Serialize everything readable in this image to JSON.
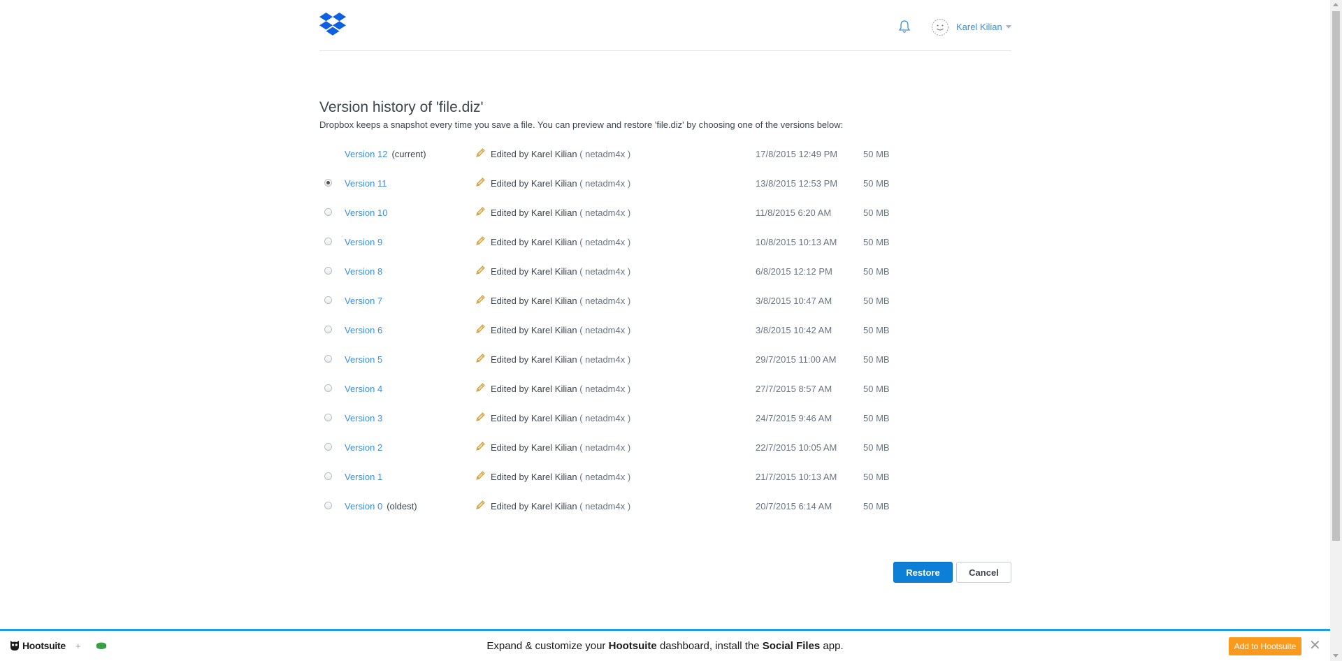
{
  "header": {
    "user_name": "Karel Kilian"
  },
  "page": {
    "title": "Version history of 'file.diz'",
    "description": "Dropbox keeps a snapshot every time you save a file. You can preview and restore 'file.diz' by choosing one of the versions below:"
  },
  "versions": [
    {
      "label": "Version 12",
      "note": "(current)",
      "editor": "Edited by Karel Kilian",
      "uid": "( netadm4x )",
      "date": "17/8/2015 12:49 PM",
      "size": "50 MB",
      "has_radio": false,
      "selected": false
    },
    {
      "label": "Version 11",
      "note": "",
      "editor": "Edited by Karel Kilian",
      "uid": "( netadm4x )",
      "date": "13/8/2015 12:53 PM",
      "size": "50 MB",
      "has_radio": true,
      "selected": true
    },
    {
      "label": "Version 10",
      "note": "",
      "editor": "Edited by Karel Kilian",
      "uid": "( netadm4x )",
      "date": "11/8/2015 6:20 AM",
      "size": "50 MB",
      "has_radio": true,
      "selected": false
    },
    {
      "label": "Version 9",
      "note": "",
      "editor": "Edited by Karel Kilian",
      "uid": "( netadm4x )",
      "date": "10/8/2015 10:13 AM",
      "size": "50 MB",
      "has_radio": true,
      "selected": false
    },
    {
      "label": "Version 8",
      "note": "",
      "editor": "Edited by Karel Kilian",
      "uid": "( netadm4x )",
      "date": "6/8/2015 12:12 PM",
      "size": "50 MB",
      "has_radio": true,
      "selected": false
    },
    {
      "label": "Version 7",
      "note": "",
      "editor": "Edited by Karel Kilian",
      "uid": "( netadm4x )",
      "date": "3/8/2015 10:47 AM",
      "size": "50 MB",
      "has_radio": true,
      "selected": false
    },
    {
      "label": "Version 6",
      "note": "",
      "editor": "Edited by Karel Kilian",
      "uid": "( netadm4x )",
      "date": "3/8/2015 10:42 AM",
      "size": "50 MB",
      "has_radio": true,
      "selected": false
    },
    {
      "label": "Version 5",
      "note": "",
      "editor": "Edited by Karel Kilian",
      "uid": "( netadm4x )",
      "date": "29/7/2015 11:00 AM",
      "size": "50 MB",
      "has_radio": true,
      "selected": false
    },
    {
      "label": "Version 4",
      "note": "",
      "editor": "Edited by Karel Kilian",
      "uid": "( netadm4x )",
      "date": "27/7/2015 8:57 AM",
      "size": "50 MB",
      "has_radio": true,
      "selected": false
    },
    {
      "label": "Version 3",
      "note": "",
      "editor": "Edited by Karel Kilian",
      "uid": "( netadm4x )",
      "date": "24/7/2015 9:46 AM",
      "size": "50 MB",
      "has_radio": true,
      "selected": false
    },
    {
      "label": "Version 2",
      "note": "",
      "editor": "Edited by Karel Kilian",
      "uid": "( netadm4x )",
      "date": "22/7/2015 10:05 AM",
      "size": "50 MB",
      "has_radio": true,
      "selected": false
    },
    {
      "label": "Version 1",
      "note": "",
      "editor": "Edited by Karel Kilian",
      "uid": "( netadm4x )",
      "date": "21/7/2015 10:13 AM",
      "size": "50 MB",
      "has_radio": true,
      "selected": false
    },
    {
      "label": "Version 0",
      "note": "(oldest)",
      "editor": "Edited by Karel Kilian",
      "uid": "( netadm4x )",
      "date": "20/7/2015 6:14 AM",
      "size": "50 MB",
      "has_radio": true,
      "selected": false
    }
  ],
  "actions": {
    "restore_label": "Restore",
    "cancel_label": "Cancel"
  },
  "hootsuite_bar": {
    "brand": "Hootsuite",
    "plus": "+",
    "text_before": "Expand & customize your ",
    "text_brand": "Hootsuite",
    "text_middle": " dashboard, install the ",
    "text_app": "Social Files",
    "text_after": " app.",
    "add_label": "Add to Hootsuite",
    "close_label": "✕"
  },
  "colors": {
    "link": "#3d8fdb",
    "primary_button": "#0e7fd7",
    "hootsuite_accent": "#1f9ee8",
    "hootsuite_button": "#f99a1c"
  },
  "icons": {
    "logo": "dropbox-logo-icon",
    "notifications": "bell-icon",
    "avatar": "avatar-face-icon",
    "edit": "pencil-icon",
    "close": "close-icon"
  }
}
